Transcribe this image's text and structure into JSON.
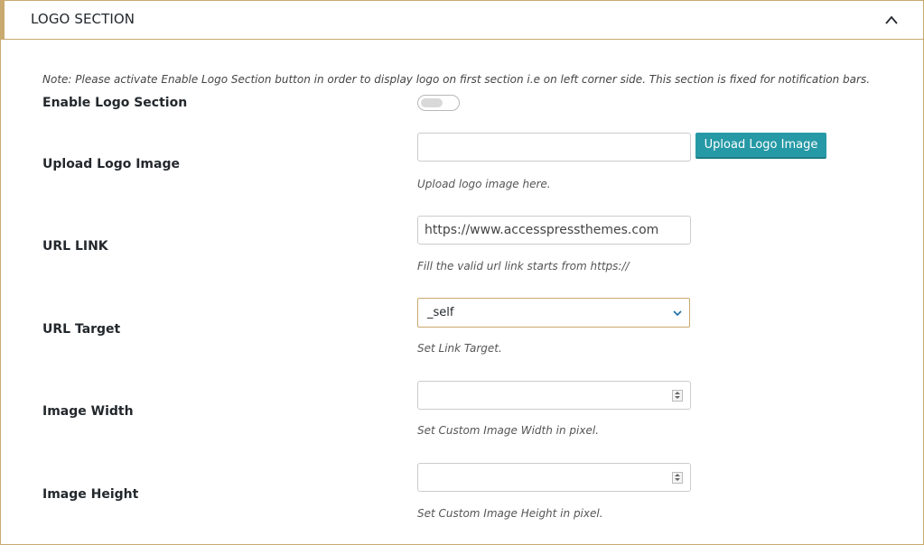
{
  "header": {
    "title": "LOGO SECTION"
  },
  "note": "Note: Please activate Enable Logo Section button in order to display logo on first section i.e on left corner side. This section is fixed for notification bars.",
  "fields": {
    "enable": {
      "label": "Enable Logo Section",
      "enabled": false
    },
    "upload": {
      "label": "Upload Logo Image",
      "value": "",
      "button": "Upload Logo Image",
      "help": "Upload logo image here."
    },
    "url": {
      "label": "URL LINK",
      "value": "https://www.accesspressthemes.com",
      "help": "Fill the valid url link starts from https://"
    },
    "target": {
      "label": "URL Target",
      "value": "_self",
      "help": "Set Link Target."
    },
    "width": {
      "label": "Image Width",
      "value": "",
      "help": "Set Custom Image Width in pixel."
    },
    "height": {
      "label": "Image Height",
      "value": "",
      "help": "Set Custom Image Height in pixel."
    }
  },
  "colors": {
    "accent": "#c9a96e",
    "button": "#2699a6"
  },
  "icons": {
    "collapse": "chevron-up-icon",
    "select": "chevron-down-icon",
    "spinner": "spinner-arrows-icon"
  }
}
